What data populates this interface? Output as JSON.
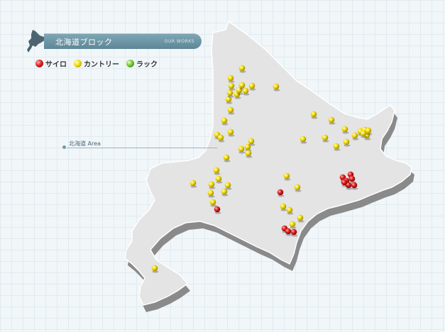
{
  "header": {
    "title": "北海道ブロック",
    "subtitle": "OUR WORKS"
  },
  "legend": [
    {
      "label": "サイロ",
      "color": "#cc1a1a",
      "icon": "red-pin-icon"
    },
    {
      "label": "カントリー",
      "color": "#e8d200",
      "icon": "yellow-pin-icon"
    },
    {
      "label": "ラック",
      "color": "#6cc22a",
      "icon": "green-pin-icon"
    }
  ],
  "area_label": "北海道 Area",
  "colors": {
    "land": "#e4e4e4",
    "side": "#8a8a8a",
    "accent": "#6f9aab"
  },
  "markers": {
    "silo": [
      [
        306,
        295
      ],
      [
        395,
        271
      ],
      [
        401,
        322
      ],
      [
        406,
        326
      ],
      [
        414,
        327
      ],
      [
        483,
        250
      ],
      [
        488,
        255
      ],
      [
        494,
        246
      ],
      [
        491,
        261
      ],
      [
        496,
        252
      ],
      [
        499,
        261
      ],
      [
        485,
        257
      ]
    ],
    "country": [
      [
        218,
        378
      ],
      [
        272,
        258
      ],
      [
        297,
        272
      ],
      [
        300,
        285
      ],
      [
        298,
        260
      ],
      [
        305,
        240
      ],
      [
        308,
        252
      ],
      [
        316,
        270
      ],
      [
        321,
        261
      ],
      [
        319,
        222
      ],
      [
        316,
        170
      ],
      [
        306,
        190
      ],
      [
        311,
        194
      ],
      [
        325,
        186
      ],
      [
        325,
        155
      ],
      [
        322,
        140
      ],
      [
        324,
        131
      ],
      [
        326,
        121
      ],
      [
        325,
        110
      ],
      [
        334,
        133
      ],
      [
        337,
        127
      ],
      [
        341,
        120
      ],
      [
        346,
        128
      ],
      [
        355,
        121
      ],
      [
        341,
        96
      ],
      [
        389,
        122
      ],
      [
        340,
        210
      ],
      [
        349,
        207
      ],
      [
        350,
        216
      ],
      [
        354,
        199
      ],
      [
        442,
        161
      ],
      [
        467,
        169
      ],
      [
        486,
        182
      ],
      [
        500,
        191
      ],
      [
        508,
        185
      ],
      [
        514,
        183
      ],
      [
        517,
        191
      ],
      [
        512,
        188
      ],
      [
        519,
        184
      ],
      [
        488,
        200
      ],
      [
        474,
        206
      ],
      [
        458,
        194
      ],
      [
        427,
        196
      ],
      [
        404,
        248
      ],
      [
        419,
        264
      ],
      [
        399,
        291
      ],
      [
        408,
        296
      ],
      [
        423,
        307
      ],
      [
        412,
        316
      ]
    ],
    "rack": []
  }
}
